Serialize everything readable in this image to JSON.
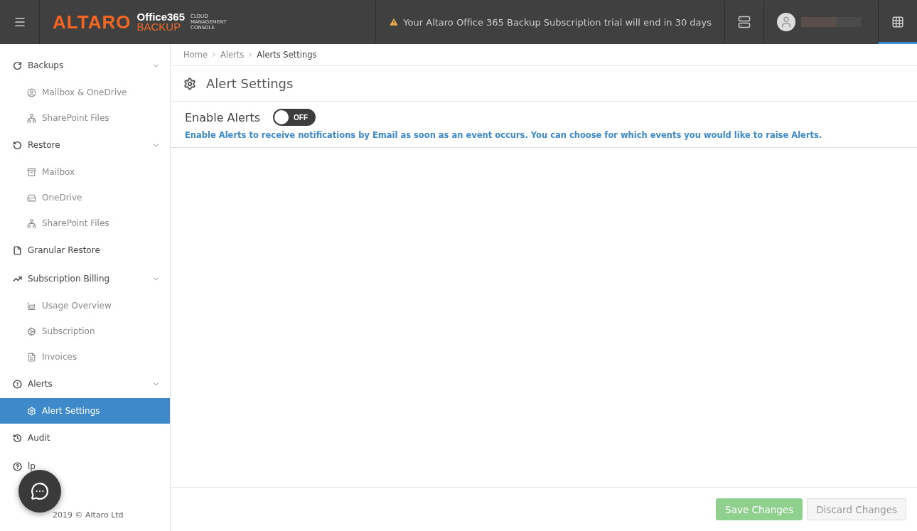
{
  "header": {
    "logo": {
      "brand": "ALTARO",
      "product_top": "Office365",
      "product_bottom": "BACKUP",
      "subtitle": [
        "CLOUD",
        "MANAGEMENT",
        "CONSOLE"
      ]
    },
    "trial_notice": "Your Altaro Office 365 Backup Subscription trial will end in 30 days",
    "apps_selected": true
  },
  "sidebar": {
    "items": [
      {
        "label": "Backups",
        "expanded": true,
        "selected": false,
        "children": [
          {
            "label": "Mailbox & OneDrive",
            "selected": false
          },
          {
            "label": "SharePoint Files",
            "selected": false
          }
        ]
      },
      {
        "label": "Restore",
        "expanded": true,
        "selected": false,
        "children": [
          {
            "label": "Mailbox",
            "selected": false
          },
          {
            "label": "OneDrive",
            "selected": false
          },
          {
            "label": "SharePoint Files",
            "selected": false
          }
        ]
      },
      {
        "label": "Granular Restore",
        "selected": false
      },
      {
        "label": "Subscription Billing",
        "expanded": true,
        "selected": false,
        "children": [
          {
            "label": "Usage Overview",
            "selected": false
          },
          {
            "label": "Subscription",
            "selected": false
          },
          {
            "label": "Invoices",
            "selected": false
          }
        ]
      },
      {
        "label": "Alerts",
        "expanded": true,
        "selected": false,
        "children": [
          {
            "label": "Alert Settings",
            "selected": true
          }
        ]
      },
      {
        "label": "Audit",
        "selected": false
      },
      {
        "label": "lp",
        "selected": false
      }
    ],
    "footer": "2019 © Altaro Ltd"
  },
  "breadcrumb": [
    "Home",
    "Alerts",
    "Alerts Settings"
  ],
  "page_title": "Alert Settings",
  "enable_alerts": {
    "label": "Enable Alerts",
    "on": false,
    "toggle_text": "OFF",
    "description": "Enable Alerts to receive notifications by Email as soon as an event occurs. You can choose for which events you would like to raise Alerts."
  },
  "buttons": [
    {
      "label": "Save Changes",
      "kind": "primary",
      "disabled": true
    },
    {
      "label": "Discard Changes",
      "kind": "secondary",
      "disabled": true
    }
  ]
}
